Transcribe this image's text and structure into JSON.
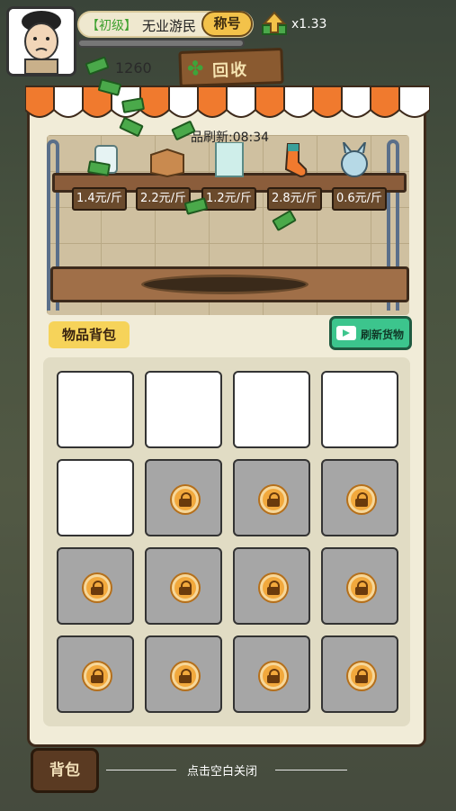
{
  "player": {
    "rank_tag": "【初级】",
    "rank_name": "无业游民",
    "title_button": "称号",
    "multiplier": "x1.33",
    "coins": "1260"
  },
  "shop": {
    "sign": "回收",
    "refresh_timer": "品刷新:08:34",
    "items": [
      {
        "icon": "glass-jar-icon",
        "price": "1.4元/斤"
      },
      {
        "icon": "cardboard-box-icon",
        "price": "2.2元/斤"
      },
      {
        "icon": "glass-pane-icon",
        "price": "1.2元/斤"
      },
      {
        "icon": "sock-icon",
        "price": "2.8元/斤"
      },
      {
        "icon": "toy-figure-icon",
        "price": "0.6元/斤"
      }
    ]
  },
  "backpack": {
    "label": "物品背包",
    "refresh_button": "刷新货物",
    "open_slots": 5,
    "locked_slots": 11
  },
  "footer": {
    "bag_button": "背包",
    "close_hint": "点击空白关闭"
  },
  "colors": {
    "accent_green": "#3cc58d",
    "label_yellow": "#f6d35a",
    "wood": "#8b5d3b"
  }
}
